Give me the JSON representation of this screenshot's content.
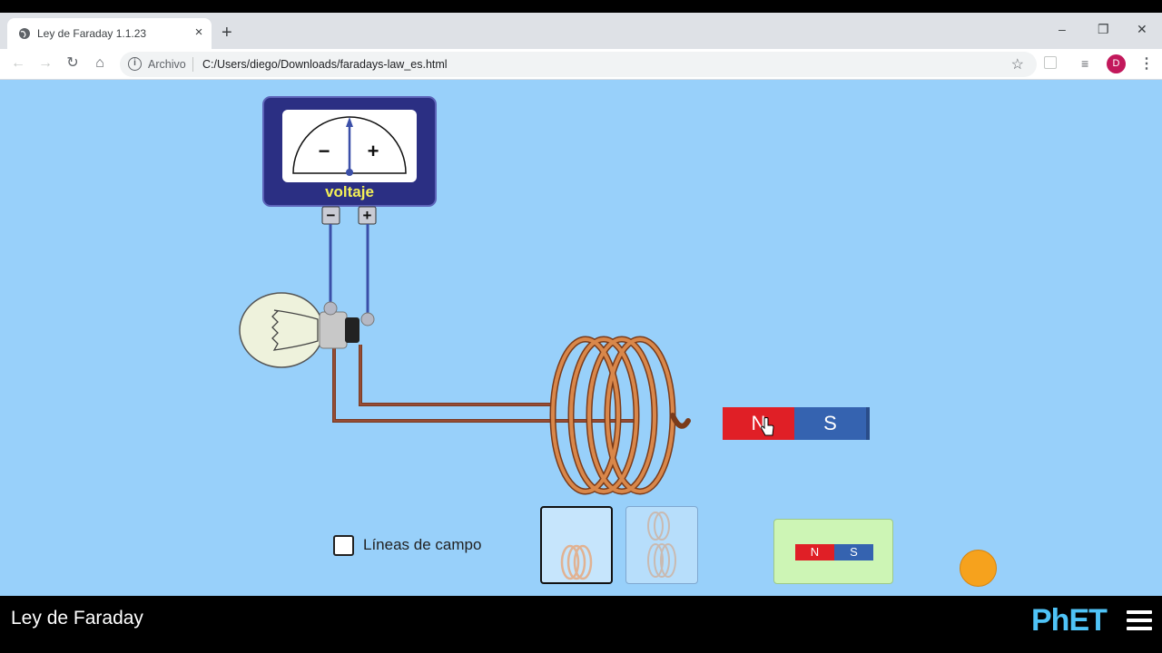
{
  "browser": {
    "tab_title": "Ley de Faraday 1.1.23",
    "tab_close": "×",
    "new_tab": "+",
    "win_minimize": "–",
    "win_restore": "❐",
    "win_close": "✕",
    "omnibox_scheme": "Archivo",
    "omnibox_url": "C:/Users/diego/Downloads/faradays-law_es.html",
    "avatar_letter": "D"
  },
  "sim": {
    "meter_label": "voltaje",
    "meter_minus": "−",
    "meter_plus": "+",
    "terminal_minus": "−",
    "terminal_plus": "+",
    "field_lines_label": "Líneas de campo",
    "field_lines_checked": false,
    "magnet_n": "N",
    "magnet_s": "S",
    "flip_n": "N",
    "flip_s": "S",
    "selected_coil": "one-coil",
    "colors": {
      "background": "#98d0fa",
      "meter_frame": "#2b2f83",
      "magnet_north": "#e01f26",
      "magnet_south": "#3563b0",
      "coil": "#c8733a",
      "wire": "#7a3b22",
      "lead": "#3b4fa8"
    }
  },
  "footer": {
    "title": "Ley de Faraday",
    "logo": "PhET"
  }
}
